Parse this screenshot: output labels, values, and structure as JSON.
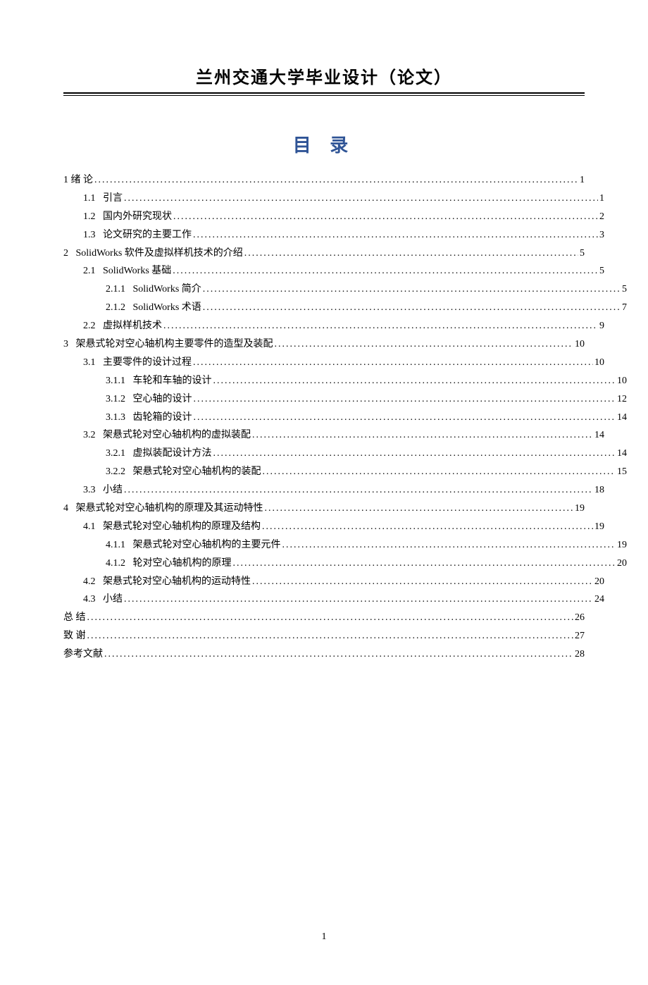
{
  "header": {
    "title": "兰州交通大学毕业设计（论文）"
  },
  "toc_title": "目 录",
  "page_number": "1",
  "toc": [
    {
      "level": 0,
      "num": "1",
      "label": "绪 论",
      "page": "1",
      "spaced": true
    },
    {
      "level": 1,
      "num": "1.1",
      "label": "引言",
      "page": "1"
    },
    {
      "level": 1,
      "num": "1.2",
      "label": "国内外研究现状",
      "page": "2"
    },
    {
      "level": 1,
      "num": "1.3",
      "label": "论文研究的主要工作",
      "page": "3"
    },
    {
      "level": 0,
      "num": "2",
      "label": "SolidWorks 软件及虚拟样机技术的介绍",
      "page": "5"
    },
    {
      "level": 1,
      "num": "2.1",
      "label": "SolidWorks 基础",
      "page": "5"
    },
    {
      "level": 2,
      "num": "2.1.1",
      "label": "SolidWorks 简介",
      "page": "5"
    },
    {
      "level": 2,
      "num": "2.1.2",
      "label": "SolidWorks  术语",
      "page": "7"
    },
    {
      "level": 1,
      "num": "2.2",
      "label": "虚拟样机技术",
      "page": "9"
    },
    {
      "level": 0,
      "num": "3",
      "label": "架悬式轮对空心轴机构主要零件的造型及装配",
      "page": "10"
    },
    {
      "level": 1,
      "num": "3.1",
      "label": "主要零件的设计过程",
      "page": "10"
    },
    {
      "level": 2,
      "num": "3.1.1",
      "label": "车轮和车轴的设计",
      "page": "10"
    },
    {
      "level": 2,
      "num": "3.1.2",
      "label": "空心轴的设计",
      "page": "12"
    },
    {
      "level": 2,
      "num": "3.1.3",
      "label": "齿轮箱的设计",
      "page": "14"
    },
    {
      "level": 1,
      "num": "3.2",
      "label": "架悬式轮对空心轴机构的虚拟装配",
      "page": "14"
    },
    {
      "level": 2,
      "num": "3.2.1",
      "label": "虚拟装配设计方法",
      "page": "14"
    },
    {
      "level": 2,
      "num": "3.2.2",
      "label": "架悬式轮对空心轴机构的装配",
      "page": "15"
    },
    {
      "level": 1,
      "num": "3.3",
      "label": "小结",
      "page": "18"
    },
    {
      "level": 0,
      "num": "4",
      "label": "架悬式轮对空心轴机构的原理及其运动特性",
      "page": "19"
    },
    {
      "level": 1,
      "num": "4.1",
      "label": "架悬式轮对空心轴机构的原理及结构",
      "page": "19"
    },
    {
      "level": 2,
      "num": "4.1.1",
      "label": "架悬式轮对空心轴机构的主要元件",
      "page": "19"
    },
    {
      "level": 2,
      "num": "4.1.2",
      "label": "轮对空心轴机构的原理",
      "page": "20"
    },
    {
      "level": 1,
      "num": "4.2",
      "label": "架悬式轮对空心轴机构的运动特性",
      "page": "20"
    },
    {
      "level": 1,
      "num": "4.3",
      "label": "小结",
      "page": "24"
    },
    {
      "level": 0,
      "num": "",
      "label": "总 结",
      "page": "26"
    },
    {
      "level": 0,
      "num": "",
      "label": "致 谢",
      "page": "27"
    },
    {
      "level": 0,
      "num": "",
      "label": "参考文献",
      "page": "28"
    }
  ]
}
